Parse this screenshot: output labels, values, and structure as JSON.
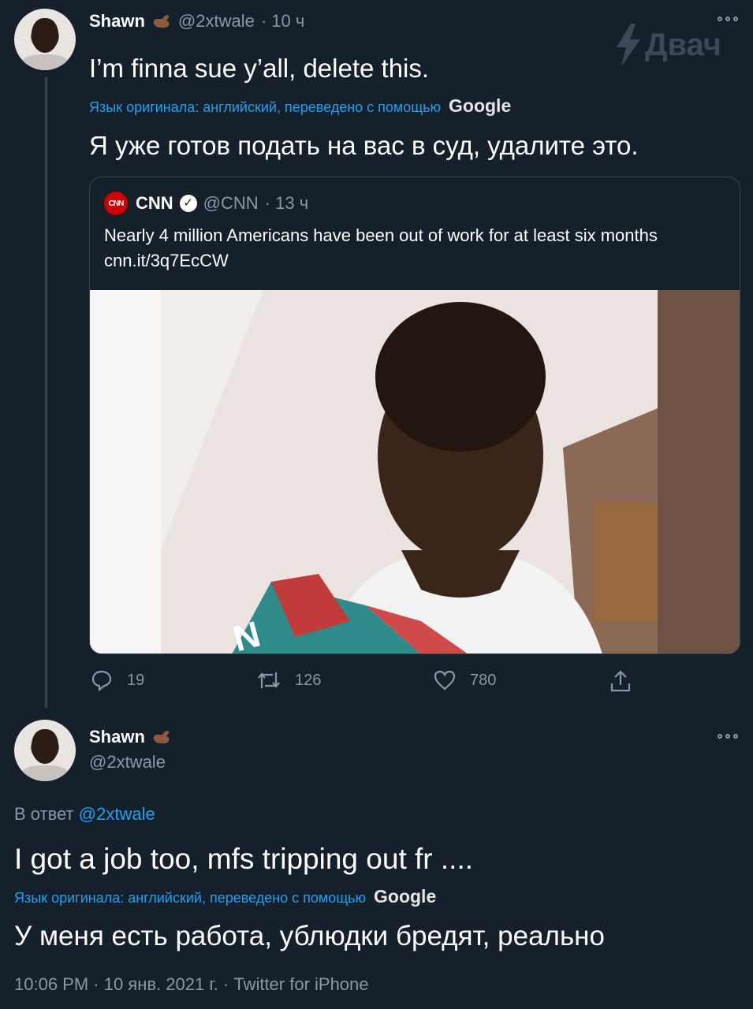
{
  "watermark": "Двач",
  "tweet1": {
    "name": "Shawn",
    "handle": "@2xtwale",
    "time": "· 10 ч",
    "text": "I’m finna sue y’all, delete this.",
    "translation_note": "Язык оригинала: английский, переведено с помощью",
    "translation_brand": "Google",
    "translation": "Я уже готов подать на вас в суд, удалите это.",
    "quote": {
      "logo": "CNN",
      "name": "CNN",
      "handle": "@CNN",
      "time": "· 13 ч",
      "text": "Nearly 4 million Americans have been out of work for at least six months",
      "link": "cnn.it/3q7EcCW"
    },
    "actions": {
      "replies": "19",
      "retweets": "126",
      "likes": "780"
    }
  },
  "tweet2": {
    "name": "Shawn",
    "handle": "@2xtwale",
    "reply_prefix": "В ответ",
    "reply_to": "@2xtwale",
    "text": "I got a job too, mfs tripping out fr ....",
    "translation_note": "Язык оригинала: английский, переведено с помощью",
    "translation_brand": "Google",
    "translation": "У меня есть работа, ублюдки бредят, реально",
    "meta": "10:06 PM · 10 янв. 2021 г. · Twitter for iPhone"
  },
  "icons": [
    "reply-icon",
    "retweet-icon",
    "like-icon",
    "share-icon",
    "more-icon",
    "call-me-hand-emoji",
    "verified-badge-icon",
    "lightning-icon"
  ],
  "colors": {
    "background": "#15202b",
    "link": "#1da1f2",
    "muted": "#8899a6",
    "border": "#38444d",
    "cnn_red": "#cc0000"
  }
}
